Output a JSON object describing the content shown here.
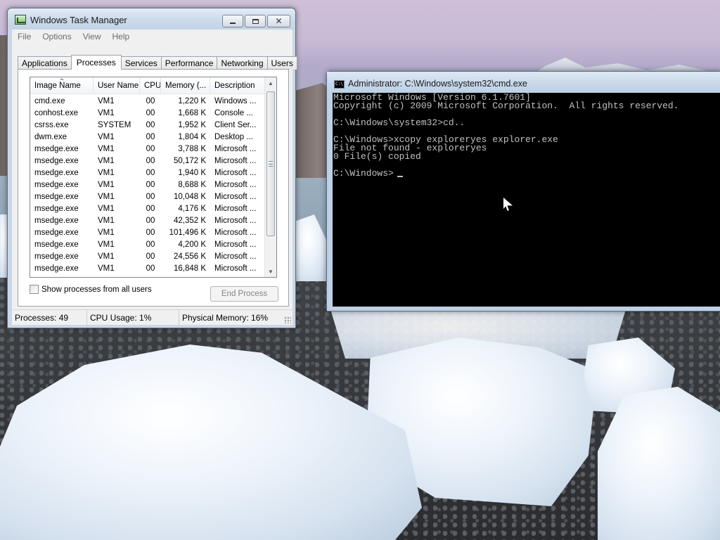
{
  "task_manager": {
    "title": "Windows Task Manager",
    "menu": [
      "File",
      "Options",
      "View",
      "Help"
    ],
    "tabs": [
      "Applications",
      "Processes",
      "Services",
      "Performance",
      "Networking",
      "Users"
    ],
    "active_tab": "Processes",
    "columns": [
      "Image Name",
      "User Name",
      "CPU",
      "Memory (...",
      "Description"
    ],
    "processes": [
      {
        "name": "cmd.exe",
        "user": "VM1",
        "cpu": "00",
        "mem": "1,220 K",
        "desc": "Windows ..."
      },
      {
        "name": "conhost.exe",
        "user": "VM1",
        "cpu": "00",
        "mem": "1,668 K",
        "desc": "Console ..."
      },
      {
        "name": "csrss.exe",
        "user": "SYSTEM",
        "cpu": "00",
        "mem": "1,952 K",
        "desc": "Client Ser..."
      },
      {
        "name": "dwm.exe",
        "user": "VM1",
        "cpu": "00",
        "mem": "1,804 K",
        "desc": "Desktop ..."
      },
      {
        "name": "msedge.exe",
        "user": "VM1",
        "cpu": "00",
        "mem": "3,788 K",
        "desc": "Microsoft ..."
      },
      {
        "name": "msedge.exe",
        "user": "VM1",
        "cpu": "00",
        "mem": "50,172 K",
        "desc": "Microsoft ..."
      },
      {
        "name": "msedge.exe",
        "user": "VM1",
        "cpu": "00",
        "mem": "1,940 K",
        "desc": "Microsoft ..."
      },
      {
        "name": "msedge.exe",
        "user": "VM1",
        "cpu": "00",
        "mem": "8,688 K",
        "desc": "Microsoft ..."
      },
      {
        "name": "msedge.exe",
        "user": "VM1",
        "cpu": "00",
        "mem": "10,048 K",
        "desc": "Microsoft ..."
      },
      {
        "name": "msedge.exe",
        "user": "VM1",
        "cpu": "00",
        "mem": "4,176 K",
        "desc": "Microsoft ..."
      },
      {
        "name": "msedge.exe",
        "user": "VM1",
        "cpu": "00",
        "mem": "42,352 K",
        "desc": "Microsoft ..."
      },
      {
        "name": "msedge.exe",
        "user": "VM1",
        "cpu": "00",
        "mem": "101,496 K",
        "desc": "Microsoft ..."
      },
      {
        "name": "msedge.exe",
        "user": "VM1",
        "cpu": "00",
        "mem": "4,200 K",
        "desc": "Microsoft ..."
      },
      {
        "name": "msedge.exe",
        "user": "VM1",
        "cpu": "00",
        "mem": "24,556 K",
        "desc": "Microsoft ..."
      },
      {
        "name": "msedge.exe",
        "user": "VM1",
        "cpu": "00",
        "mem": "16,848 K",
        "desc": "Microsoft ..."
      }
    ],
    "show_all_label": "Show processes from all users",
    "show_all_checked": false,
    "end_process_label": "End Process",
    "status": {
      "processes": "Processes: 49",
      "cpu": "CPU Usage: 1%",
      "memory": "Physical Memory: 16%"
    }
  },
  "cmd": {
    "title": "Administrator: C:\\Windows\\system32\\cmd.exe",
    "icon_text": "C:\\",
    "lines": [
      "Microsoft Windows [Version 6.1.7601]",
      "Copyright (c) 2009 Microsoft Corporation.  All rights reserved.",
      "",
      "C:\\Windows\\system32>cd..",
      "",
      "C:\\Windows>xcopy exploreryes explorer.exe",
      "File not found - exploreryes",
      "0 File(s) copied",
      "",
      "C:\\Windows>"
    ]
  },
  "icons": {
    "minimize": "minimize-icon",
    "maximize": "maximize-icon",
    "close": "close-icon",
    "scroll_up": "scroll-up-icon",
    "scroll_down": "scroll-down-icon"
  }
}
